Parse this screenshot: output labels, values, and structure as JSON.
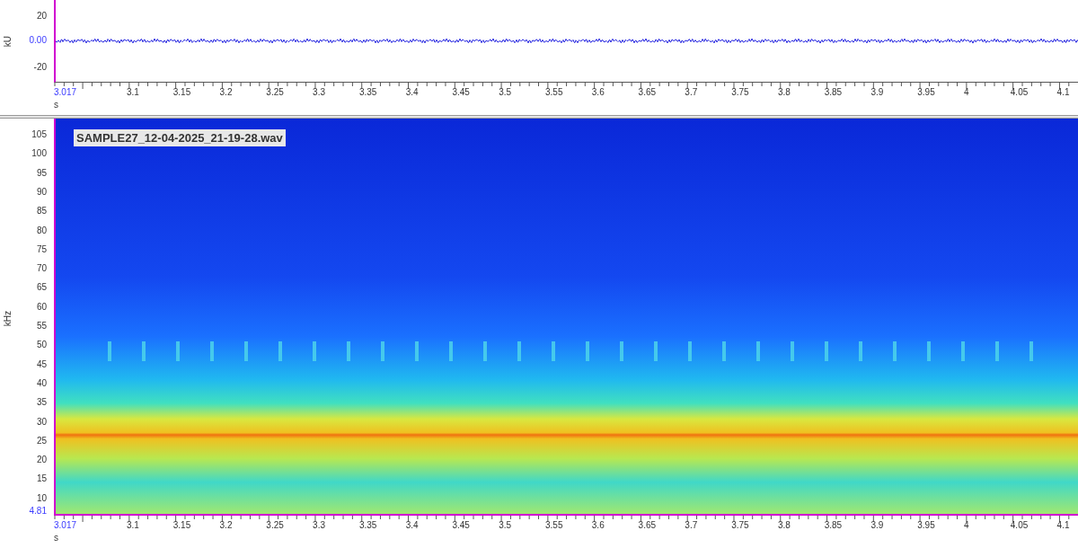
{
  "waveform": {
    "y_unit": "kU",
    "x_unit": "s",
    "y_ticks": [
      {
        "label": "20",
        "kind": "normal"
      },
      {
        "label": "0.00",
        "kind": "origin"
      },
      {
        "label": "-20",
        "kind": "normal"
      }
    ],
    "x_ticks": [
      {
        "label": "3.017",
        "kind": "start"
      },
      {
        "label": "3.1",
        "kind": "normal"
      },
      {
        "label": "3.15",
        "kind": "normal"
      },
      {
        "label": "3.2",
        "kind": "normal"
      },
      {
        "label": "3.25",
        "kind": "normal"
      },
      {
        "label": "3.3",
        "kind": "normal"
      },
      {
        "label": "3.35",
        "kind": "normal"
      },
      {
        "label": "3.4",
        "kind": "normal"
      },
      {
        "label": "3.45",
        "kind": "normal"
      },
      {
        "label": "3.5",
        "kind": "normal"
      },
      {
        "label": "3.55",
        "kind": "normal"
      },
      {
        "label": "3.6",
        "kind": "normal"
      },
      {
        "label": "3.65",
        "kind": "normal"
      },
      {
        "label": "3.7",
        "kind": "normal"
      },
      {
        "label": "3.75",
        "kind": "normal"
      },
      {
        "label": "3.8",
        "kind": "normal"
      },
      {
        "label": "3.85",
        "kind": "normal"
      },
      {
        "label": "3.9",
        "kind": "normal"
      },
      {
        "label": "3.95",
        "kind": "normal"
      },
      {
        "label": "4",
        "kind": "normal"
      },
      {
        "label": "4.05",
        "kind": "normal"
      },
      {
        "label": "4.1",
        "kind": "normal"
      }
    ]
  },
  "spectrogram": {
    "file_label": "SAMPLE27_12-04-2025_21-19-28.wav",
    "y_unit": "kHz",
    "x_unit": "s",
    "y_ticks": [
      {
        "label": "105",
        "kind": "normal"
      },
      {
        "label": "100",
        "kind": "normal"
      },
      {
        "label": "95",
        "kind": "normal"
      },
      {
        "label": "90",
        "kind": "normal"
      },
      {
        "label": "85",
        "kind": "normal"
      },
      {
        "label": "80",
        "kind": "normal"
      },
      {
        "label": "75",
        "kind": "normal"
      },
      {
        "label": "70",
        "kind": "normal"
      },
      {
        "label": "65",
        "kind": "normal"
      },
      {
        "label": "60",
        "kind": "normal"
      },
      {
        "label": "55",
        "kind": "normal"
      },
      {
        "label": "50",
        "kind": "normal"
      },
      {
        "label": "45",
        "kind": "normal"
      },
      {
        "label": "40",
        "kind": "normal"
      },
      {
        "label": "35",
        "kind": "normal"
      },
      {
        "label": "30",
        "kind": "normal"
      },
      {
        "label": "25",
        "kind": "normal"
      },
      {
        "label": "20",
        "kind": "normal"
      },
      {
        "label": "15",
        "kind": "normal"
      },
      {
        "label": "10",
        "kind": "normal"
      },
      {
        "label": "4.81",
        "kind": "start"
      }
    ],
    "x_ticks": [
      {
        "label": "3.017",
        "kind": "start"
      },
      {
        "label": "3.1",
        "kind": "normal"
      },
      {
        "label": "3.15",
        "kind": "normal"
      },
      {
        "label": "3.2",
        "kind": "normal"
      },
      {
        "label": "3.25",
        "kind": "normal"
      },
      {
        "label": "3.3",
        "kind": "normal"
      },
      {
        "label": "3.35",
        "kind": "normal"
      },
      {
        "label": "3.4",
        "kind": "normal"
      },
      {
        "label": "3.45",
        "kind": "normal"
      },
      {
        "label": "3.5",
        "kind": "normal"
      },
      {
        "label": "3.55",
        "kind": "normal"
      },
      {
        "label": "3.6",
        "kind": "normal"
      },
      {
        "label": "3.65",
        "kind": "normal"
      },
      {
        "label": "3.7",
        "kind": "normal"
      },
      {
        "label": "3.75",
        "kind": "normal"
      },
      {
        "label": "3.8",
        "kind": "normal"
      },
      {
        "label": "3.85",
        "kind": "normal"
      },
      {
        "label": "3.9",
        "kind": "normal"
      },
      {
        "label": "3.95",
        "kind": "normal"
      },
      {
        "label": "4",
        "kind": "normal"
      },
      {
        "label": "4.05",
        "kind": "normal"
      },
      {
        "label": "4.1",
        "kind": "normal"
      }
    ]
  }
}
